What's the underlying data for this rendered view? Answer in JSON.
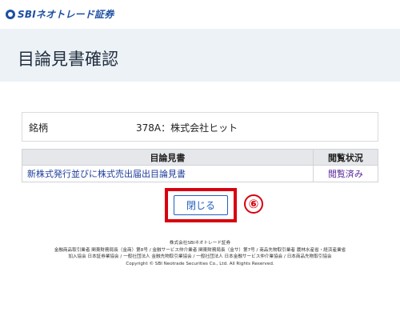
{
  "brand": {
    "logo_text": "SBIネオトレード証券",
    "color": "#1d4fa3"
  },
  "page": {
    "title": "目論見書確認"
  },
  "security": {
    "label": "銘柄",
    "value": "378A：株式会社ヒット"
  },
  "docs_table": {
    "headers": [
      "目論見書",
      "閲覧状況"
    ],
    "rows": [
      {
        "document": "新株式発行並びに株式売出届出目論見書",
        "status": "閲覧済み"
      }
    ]
  },
  "actions": {
    "close_label": "閉じる"
  },
  "annotation": {
    "step_marker": "⑥",
    "highlight_color": "#d7000f"
  },
  "footer": {
    "lines": [
      "株式会社SBIネオトレード証券",
      "金融商品取引業者 関東財務局長（金商）第8号 / 金融サービス仲介業者 関東財務局長（金サ）第7号 / 商品先物取引業者 農林水産省・経済産業省",
      "加入協会 日本証券業協会 / 一般社団法人 金融先物取引業協会 / 一般社団法人 日本金融サービス仲介業協会 / 日本商品先物取引協会",
      "Copyright © SBI Neotrade Securities Co., Ltd. All Rights Reserved."
    ]
  }
}
